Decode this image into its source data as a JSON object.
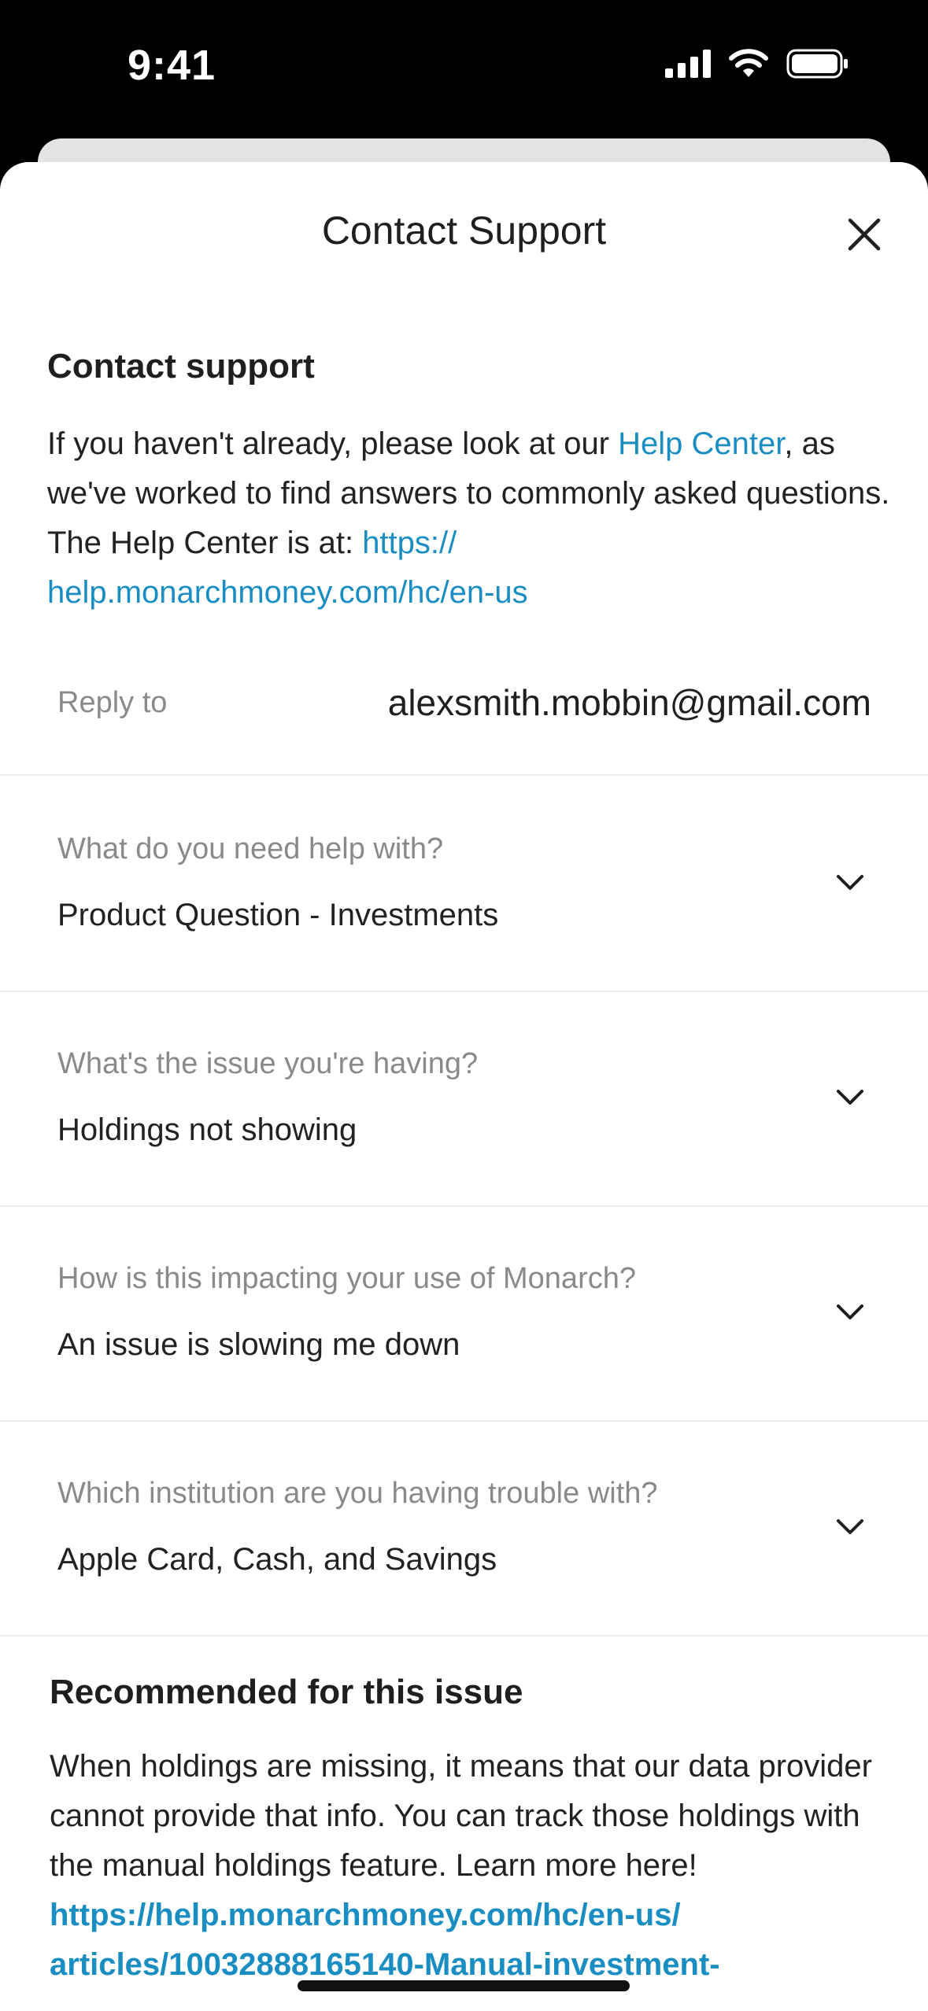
{
  "status": {
    "time": "9:41"
  },
  "header": {
    "title": "Contact Support",
    "close_icon": "close-icon"
  },
  "intro": {
    "title": "Contact support",
    "text_before_link": "If you haven't already, please look at our ",
    "help_center_link": "Help Center",
    "text_middle": ", as we've worked to find answers to commonly asked questions. The Help Center is at: ",
    "url_link": "https://\nhelp.monarchmoney.com/hc/en-us"
  },
  "reply": {
    "label": "Reply to",
    "value": "alexsmith.mobbin@gmail.com"
  },
  "dropdowns": [
    {
      "label": "What do you need help with?",
      "value": "Product Question - Investments"
    },
    {
      "label": "What's the issue you're having?",
      "value": "Holdings not showing"
    },
    {
      "label": "How is this impacting your use of Monarch?",
      "value": "An issue is slowing me down"
    },
    {
      "label": "Which institution are you having trouble with?",
      "value": "Apple Card, Cash, and Savings"
    }
  ],
  "recommended": {
    "title": "Recommended for this issue",
    "text": "When holdings are missing, it means that our data provider cannot provide that info. You can track those holdings with the manual holdings feature. Learn more here! ",
    "link": "https://help.monarchmoney.com/hc/en-us/ articles/10032888165140-Manual-investment-"
  },
  "colors": {
    "link": "#1a8ec2",
    "label_gray": "#8a8a8a",
    "divider": "#ececec"
  }
}
